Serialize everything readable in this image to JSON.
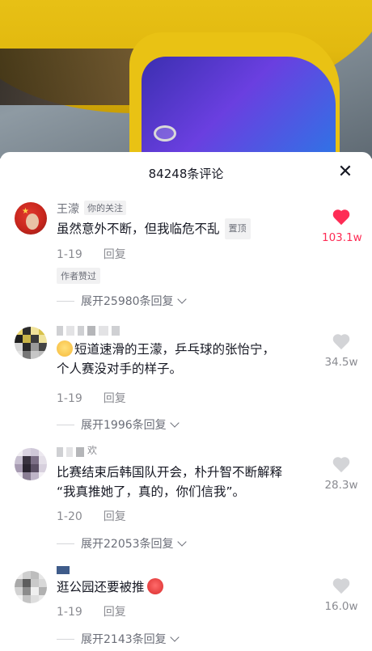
{
  "sheet": {
    "title": "84248条评论",
    "close_icon": "close-icon"
  },
  "comments": [
    {
      "name": "王濛",
      "follow_tag": "你的关注",
      "text": "虽然意外不断，但我临危不乱",
      "pin_tag": "置顶",
      "date": "1-19",
      "reply_label": "回复",
      "author_liked": "作者赞过",
      "expand_label": "展开25980条回复",
      "likes": "103.1w",
      "liked": true,
      "heart_color": "#fe2c55"
    },
    {
      "text_line1": "短道速滑的王濛，乒乓球的张怡宁，",
      "text_line2": "个人赛没对手的样子。",
      "date": "1-19",
      "reply_label": "回复",
      "expand_label": "展开1996条回复",
      "likes": "34.5w",
      "liked": false
    },
    {
      "name_suffix": "欢",
      "text_line1": "比赛结束后韩国队开会，朴升智不断解释",
      "text_line2": "“我真推她了，真的，你们信我”。",
      "date": "1-20",
      "reply_label": "回复",
      "expand_label": "展开22053条回复",
      "likes": "28.3w",
      "liked": false
    },
    {
      "text": "逛公园还要被推",
      "date": "1-19",
      "reply_label": "回复",
      "expand_label": "展开2143条回复",
      "likes": "16.0w",
      "liked": false
    }
  ]
}
